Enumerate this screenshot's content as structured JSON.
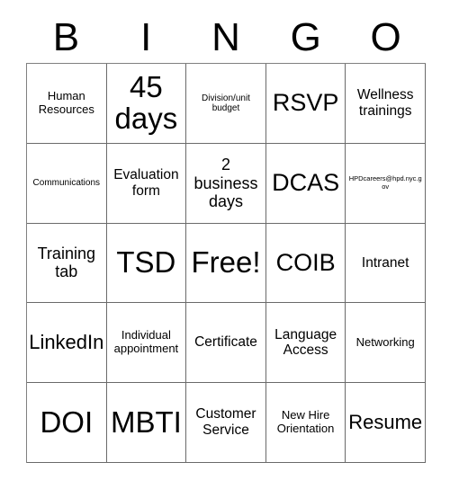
{
  "card": {
    "title": "BINGO",
    "header_letters": [
      "B",
      "I",
      "N",
      "G",
      "O"
    ],
    "grid_size": "5x5",
    "free_space_label": "Free!",
    "colors": {
      "background": "#ffffff",
      "text": "#000000",
      "grid_line": "#6a6a6a"
    },
    "rows": [
      [
        {
          "text": "Human Resources",
          "size": "sm"
        },
        {
          "text": "45 days",
          "size": "huge"
        },
        {
          "text": "Division/unit budget",
          "size": "xs"
        },
        {
          "text": "RSVP",
          "size": "xxl"
        },
        {
          "text": "Wellness trainings",
          "size": "md"
        }
      ],
      [
        {
          "text": "Communications",
          "size": "xs"
        },
        {
          "text": "Evaluation form",
          "size": "md"
        },
        {
          "text": "2 business days",
          "size": "lg"
        },
        {
          "text": "DCAS",
          "size": "xxl"
        },
        {
          "text": "HPDcareers@hpd.nyc.gov",
          "size": "xxs"
        }
      ],
      [
        {
          "text": "Training tab",
          "size": "lg"
        },
        {
          "text": "TSD",
          "size": "huge"
        },
        {
          "text": "Free!",
          "size": "huge"
        },
        {
          "text": "COIB",
          "size": "xxl"
        },
        {
          "text": "Intranet",
          "size": "md"
        }
      ],
      [
        {
          "text": "LinkedIn",
          "size": "xl"
        },
        {
          "text": "Individual appointment",
          "size": "sm"
        },
        {
          "text": "Certificate",
          "size": "md"
        },
        {
          "text": "Language Access",
          "size": "md"
        },
        {
          "text": "Networking",
          "size": "sm"
        }
      ],
      [
        {
          "text": "DOI",
          "size": "huge"
        },
        {
          "text": "MBTI",
          "size": "huge"
        },
        {
          "text": "Customer Service",
          "size": "md"
        },
        {
          "text": "New Hire Orientation",
          "size": "sm"
        },
        {
          "text": "Resume",
          "size": "xl"
        }
      ]
    ]
  }
}
